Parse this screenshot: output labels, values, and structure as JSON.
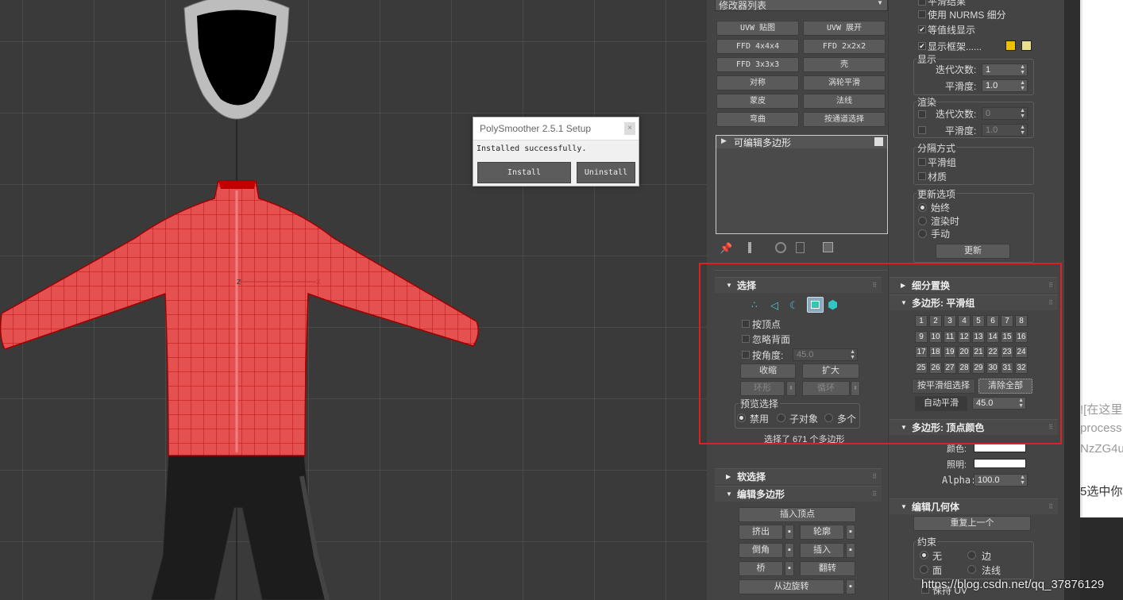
{
  "dialog": {
    "title": "PolySmoother 2.5.1 Setup",
    "close": "×",
    "message": "Installed successfully.",
    "install": "Install",
    "uninstall": "Uninstall"
  },
  "viewport": {
    "axis_z": "Z",
    "axis_x": "X"
  },
  "modifier_list": {
    "label": "修改器列表"
  },
  "modifier_buttons": [
    "UVW 贴图",
    "UVW 展开",
    "FFD 4x4x4",
    "FFD 2x2x2",
    "FFD 3x3x3",
    "壳",
    "对称",
    "涡轮平滑",
    "蒙皮",
    "法线",
    "弯曲",
    "按通道选择"
  ],
  "stack": {
    "item": "可编辑多边形"
  },
  "selection": {
    "title": "选择",
    "by_vertex": "按顶点",
    "ignore_backface": "忽略背面",
    "by_angle": "按角度:",
    "angle_value": "45.0",
    "shrink": "收缩",
    "grow": "扩大",
    "ring": "环形",
    "loop": "循环",
    "preview_title": "预览选择",
    "preview_off": "禁用",
    "preview_sub": "子对象",
    "preview_multi": "多个",
    "status": "选择了 671 个多边形"
  },
  "soft_selection": {
    "title": "软选择"
  },
  "edit_poly": {
    "title": "编辑多边形",
    "insert_vertex": "插入顶点",
    "extrude": "挤出",
    "outline": "轮廓",
    "bevel": "倒角",
    "inset": "插入",
    "bridge": "桥",
    "flip": "翻转",
    "hinge": "从边旋转"
  },
  "right_top": {
    "show_result": "平滑结果",
    "use_nurms": "使用 NURMS 细分",
    "isoline": "等值线显示",
    "show_cage": "显示框架......",
    "cage_color1": "#f0c000",
    "cage_color2": "#e8e090",
    "display": "显示",
    "iterations": "迭代次数:",
    "iter_value": "1",
    "smoothness": "平滑度:",
    "smooth_value": "1.0",
    "render": "渲染",
    "r_iterations": "迭代次数:",
    "r_iter_value": "0",
    "r_smoothness": "平滑度:",
    "r_smooth_value": "1.0",
    "separate": "分隔方式",
    "smoothing_groups": "平滑组",
    "materials": "材质",
    "update_options": "更新选项",
    "always": "始终",
    "when_render": "渲染时",
    "manual": "手动",
    "update": "更新"
  },
  "subdiv_disp": {
    "title": "细分置换"
  },
  "smoothing": {
    "title": "多边形: 平滑组",
    "groups": [
      "1",
      "2",
      "3",
      "4",
      "5",
      "6",
      "7",
      "8",
      "9",
      "10",
      "11",
      "12",
      "13",
      "14",
      "15",
      "16",
      "17",
      "18",
      "19",
      "20",
      "21",
      "22",
      "23",
      "24",
      "25",
      "26",
      "27",
      "28",
      "29",
      "30",
      "31",
      "32"
    ],
    "select_by_sg": "按平滑组选择",
    "clear_all": "清除全部",
    "auto_smooth": "自动平滑",
    "auto_value": "45.0"
  },
  "vertex_colors": {
    "title": "多边形: 顶点颜色",
    "color": "颜色:",
    "illum": "照明:",
    "alpha": "Alpha:",
    "alpha_value": "100.0"
  },
  "edit_geometry": {
    "title": "编辑几何体",
    "repeat_last": "重复上一个",
    "constraints": "约束",
    "none": "无",
    "edge": "边",
    "face": "面",
    "normal": "法线",
    "preserve_uv": "保持 UV"
  },
  "web": {
    "line1": "![在这里",
    "line2": "process",
    "line3": "NzZG4u",
    "line4": "5选中你"
  },
  "watermark": "https://blog.csdn.net/qq_37876129"
}
